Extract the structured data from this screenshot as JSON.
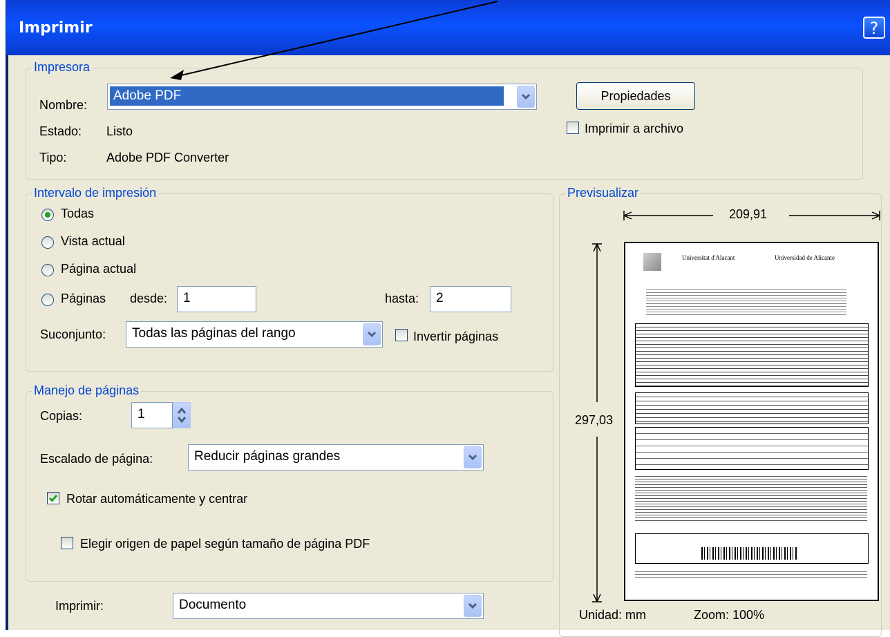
{
  "window": {
    "title": "Imprimir",
    "help_label": "?"
  },
  "printer": {
    "legend": "Impresora",
    "name_label": "Nombre:",
    "name_value": "Adobe PDF",
    "status_label": "Estado:",
    "status_value": "Listo",
    "type_label": "Tipo:",
    "type_value": "Adobe PDF Converter",
    "properties_button": "Propiedades",
    "print_to_file_label": "Imprimir a archivo",
    "print_to_file_checked": false
  },
  "range": {
    "legend": "Intervalo de impresión",
    "options": [
      {
        "label": "Todas",
        "selected": true
      },
      {
        "label": "Vista actual",
        "selected": false
      },
      {
        "label": "Página actual",
        "selected": false
      },
      {
        "label": "Páginas",
        "selected": false
      }
    ],
    "from_label": "desde:",
    "from_value": "1",
    "to_label": "hasta:",
    "to_value": "2",
    "subset_label": "Suconjunto:",
    "subset_value": "Todas las páginas del rango",
    "reverse_label": "Invertir páginas",
    "reverse_checked": false
  },
  "handling": {
    "legend": "Manejo de páginas",
    "copies_label": "Copias:",
    "copies_value": "1",
    "scaling_label": "Escalado de página:",
    "scaling_value": "Reducir páginas grandes",
    "autorotate_label": "Rotar automáticamente y centrar",
    "autorotate_checked": true,
    "paper_source_label": "Elegir origen de papel según tamaño de página PDF",
    "paper_source_checked": false
  },
  "print_what": {
    "label": "Imprimir:",
    "value": "Documento"
  },
  "preview": {
    "legend": "Previsualizar",
    "width_value": "209,91",
    "height_value": "297,03",
    "unit_label": "Unidad: mm",
    "zoom_label": "Zoom: 100%",
    "page_header_left": "Universitat d'Alacant",
    "page_header_right": "Universidad de Alicante"
  },
  "colors": {
    "title_bar": "#0a52ff",
    "dialog_bg": "#ece9d8",
    "legend_text": "#0046d5",
    "selection": "#316ac5"
  }
}
